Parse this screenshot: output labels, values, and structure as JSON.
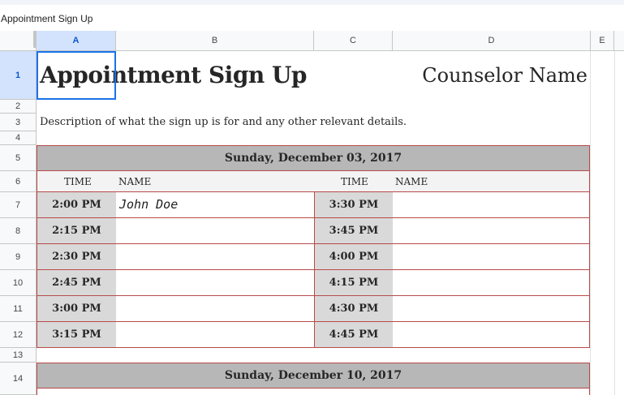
{
  "app": {
    "title": "Appointment Sign Up"
  },
  "columns": [
    "A",
    "B",
    "C",
    "D",
    "E"
  ],
  "rows": [
    "1",
    "2",
    "3",
    "4",
    "5",
    "6",
    "7",
    "8",
    "9",
    "10",
    "11",
    "12",
    "13",
    "14"
  ],
  "sheet": {
    "title": "Appointment Sign Up",
    "counselor": "Counselor Name",
    "description": "Description of what the sign up is for and any other relevant details.",
    "time_header": "TIME",
    "name_header": "NAME",
    "dates": [
      "Sunday, December 03, 2017",
      "Sunday, December 10, 2017"
    ],
    "slots": [
      {
        "left_time": "2:00 PM",
        "left_name": "John Doe",
        "right_time": "3:30 PM",
        "right_name": ""
      },
      {
        "left_time": "2:15 PM",
        "left_name": "",
        "right_time": "3:45 PM",
        "right_name": ""
      },
      {
        "left_time": "2:30 PM",
        "left_name": "",
        "right_time": "4:00 PM",
        "right_name": ""
      },
      {
        "left_time": "2:45 PM",
        "left_name": "",
        "right_time": "4:15 PM",
        "right_name": ""
      },
      {
        "left_time": "3:00 PM",
        "left_name": "",
        "right_time": "4:30 PM",
        "right_name": ""
      },
      {
        "left_time": "3:15 PM",
        "left_name": "",
        "right_time": "4:45 PM",
        "right_name": ""
      }
    ]
  },
  "colors": {
    "border": "#b84a4a",
    "date_bar": "#b7b7b7",
    "time_cell": "#d9d9d9",
    "selection": "#1a73e8"
  }
}
